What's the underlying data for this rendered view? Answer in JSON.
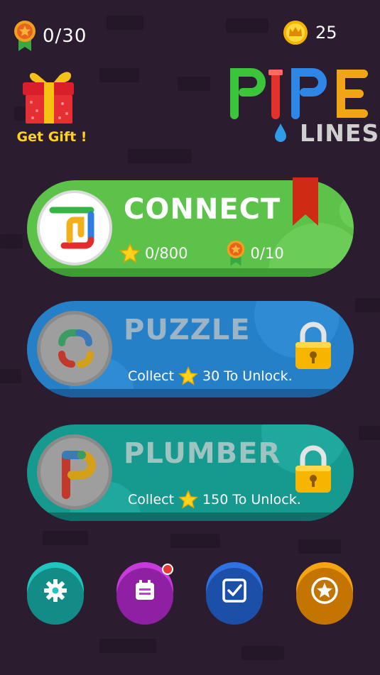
{
  "header": {
    "medal_count": "0/30",
    "coin_count": "25"
  },
  "gift": {
    "label": "Get Gift !"
  },
  "logo": {
    "word_top": "PIPE",
    "word_bottom": "LINES"
  },
  "modes": [
    {
      "title": "CONNECT",
      "stars": "0/800",
      "medals": "0/10",
      "locked": false
    },
    {
      "title": "PUZZLE",
      "unlock_prefix": "Collect",
      "unlock_amount": "30 To Unlock.",
      "locked": true
    },
    {
      "title": "PLUMBER",
      "unlock_prefix": "Collect",
      "unlock_amount": "150 To Unlock.",
      "locked": true
    }
  ],
  "bottom_bar": {
    "buttons": [
      {
        "icon": "gear-icon",
        "color": "#1fbfb8"
      },
      {
        "icon": "calendar-icon",
        "color": "#c43ad8",
        "has_notification": true
      },
      {
        "icon": "checkbox-icon",
        "color": "#2f6fe0"
      },
      {
        "icon": "star-badge-icon",
        "color": "#f5a011"
      }
    ]
  },
  "colors": {
    "background": "#2b1c2f",
    "connect": "#5cc24a",
    "puzzle": "#2680c8",
    "plumber": "#16998f",
    "gold": "#ffd21e"
  }
}
